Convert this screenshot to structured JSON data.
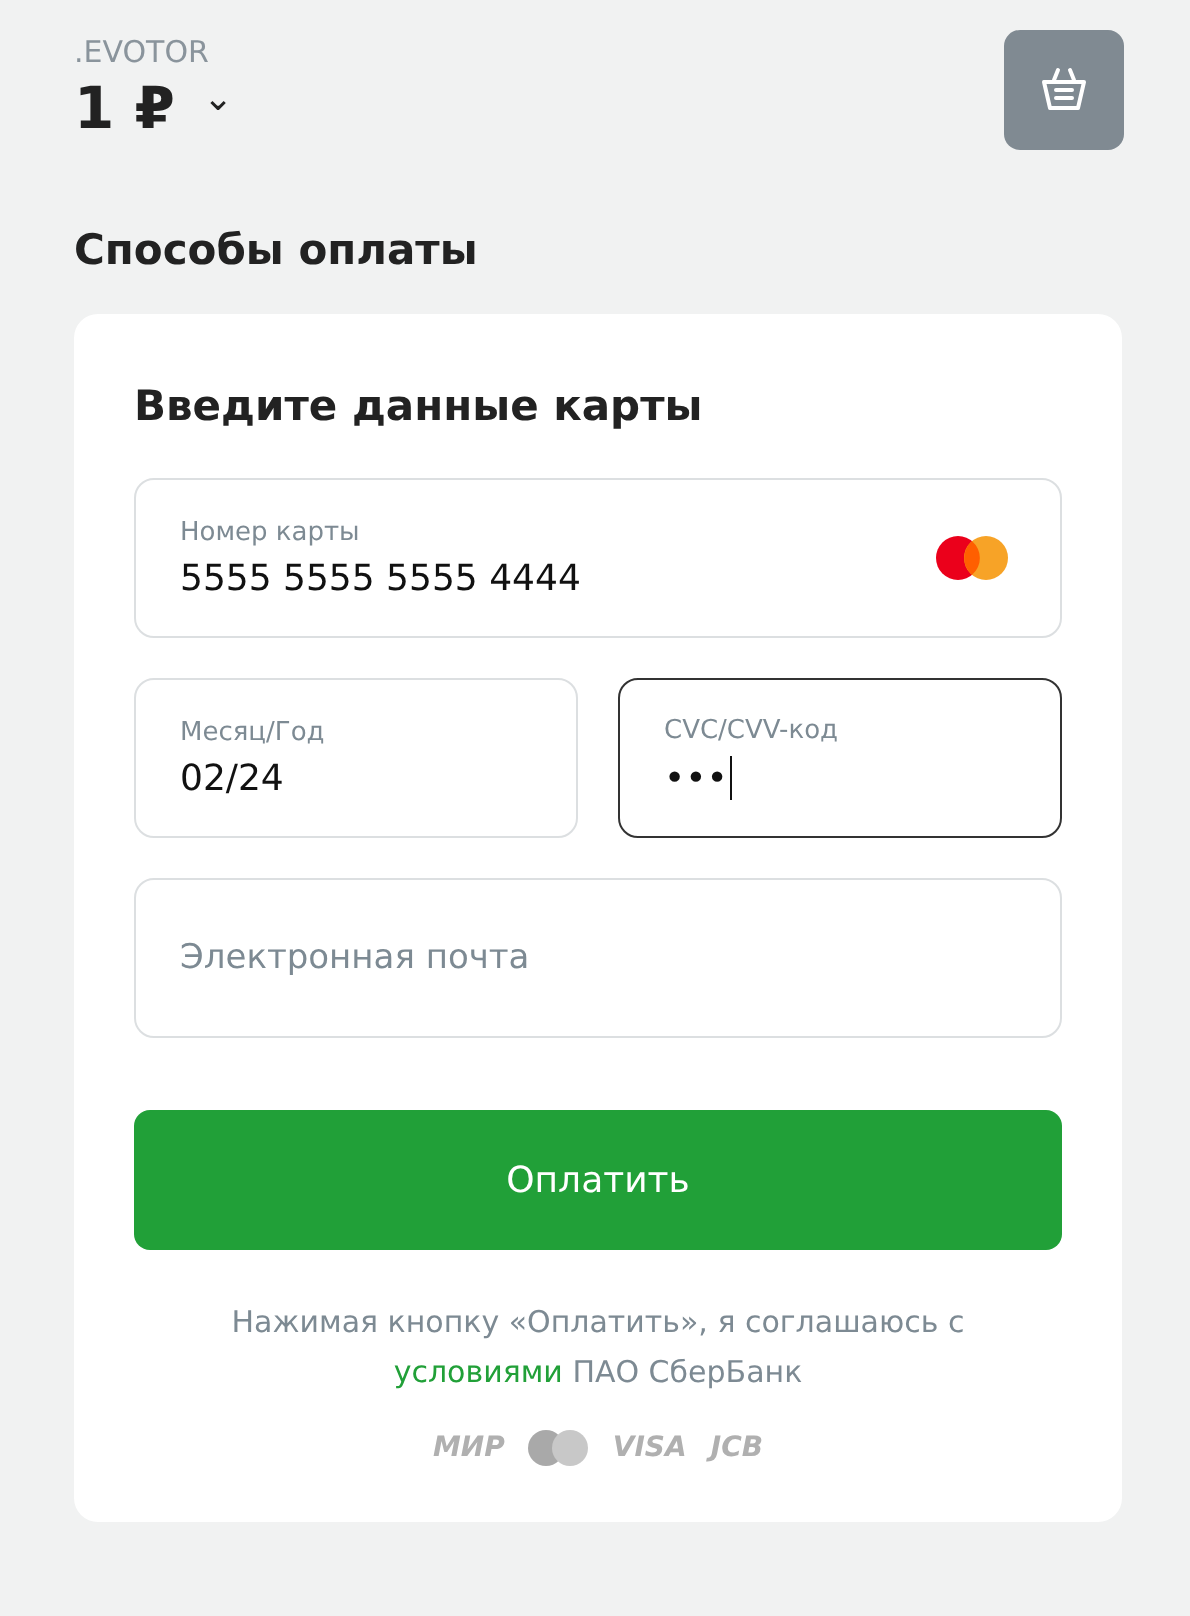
{
  "header": {
    "merchant": ".EVOTOR",
    "amount": "1 ₽",
    "caret": "⌄"
  },
  "section_title": "Способы оплаты",
  "card": {
    "title": "Введите данные карты",
    "fields": [
      {
        "kind": "card_number",
        "label": "Номер карты",
        "value": "5555 5555 5555 4444",
        "focused": false
      },
      {
        "kind": "half",
        "label": "Месяц/Год",
        "value": "02/24",
        "focused": false
      },
      {
        "kind": "half",
        "label": "CVC/CVV-код",
        "value": "•••",
        "focused": true
      },
      {
        "kind": "email",
        "placeholder": "Электронная почта",
        "focused": false
      }
    ],
    "pay_button": "Оплатить",
    "terms": "Нажимая кнопку «Оплатить», я соглашаюсь с",
    "terms_link": "условиями",
    "terms_tail": "ПАО СберБанк",
    "logos": [
      {
        "kind": "text",
        "text": "МИР"
      },
      {
        "kind": "mastercard"
      },
      {
        "kind": "text",
        "text": "VISA"
      },
      {
        "kind": "text",
        "text": "JCB"
      }
    ]
  }
}
